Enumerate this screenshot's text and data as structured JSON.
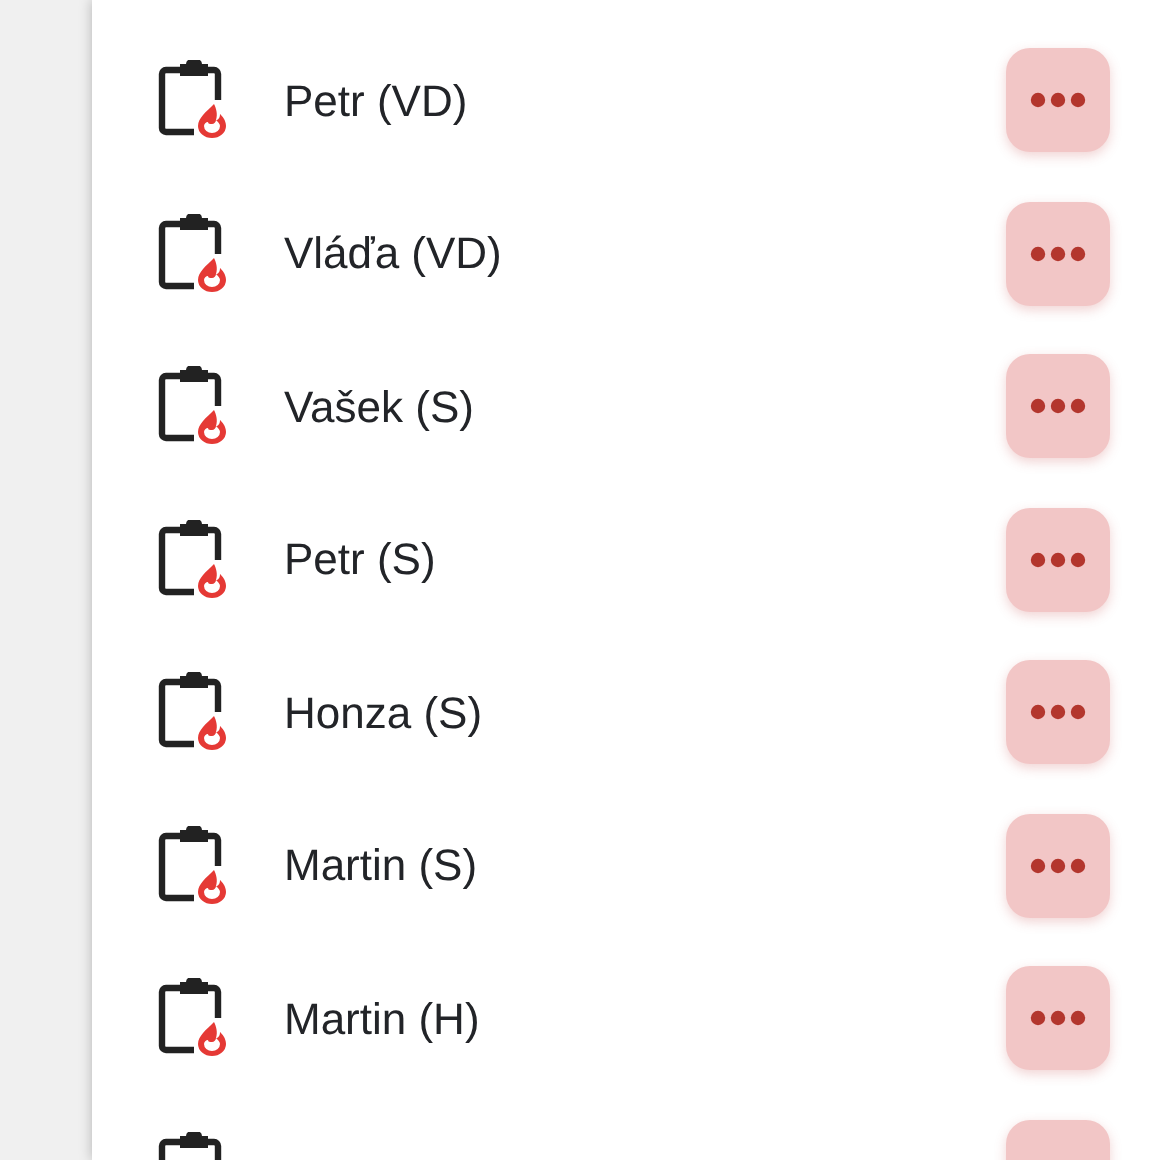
{
  "rows": [
    {
      "kind": "full",
      "name": "Petr (VD)"
    },
    {
      "kind": "full",
      "name": "Vláďa (VD)"
    },
    {
      "kind": "full",
      "name": "Vašek (S)"
    },
    {
      "kind": "full",
      "name": "Petr (S)"
    },
    {
      "kind": "full",
      "name": "Honza (S)"
    },
    {
      "kind": "full",
      "name": "Martin (S)"
    },
    {
      "kind": "full",
      "name": "Martin (H)"
    },
    {
      "kind": "cut"
    }
  ]
}
